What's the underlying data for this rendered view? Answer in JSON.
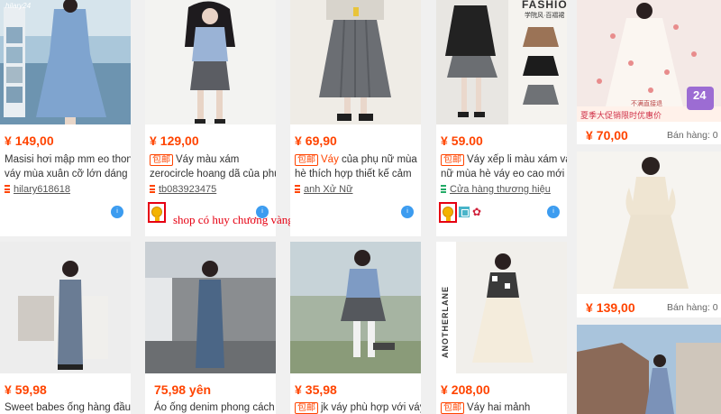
{
  "annotation": "shop có huy chương vàng",
  "row1": [
    {
      "price_currency": "¥",
      "price": "149,00",
      "title": "Masisi hơi mập mm eo thon",
      "title2": "váy mùa xuân cỡ lớn dáng",
      "shop": "hilary618618",
      "watermark": "hilary24"
    },
    {
      "price_currency": "¥",
      "price": "129,00",
      "tag": "包邮",
      "title": "Váy màu xám",
      "title2": "zerocircle hoang dã của phụ",
      "shop": "tb083923475"
    },
    {
      "price_currency": "¥",
      "price": "69,90",
      "tag": "包邮",
      "title_highlight": "Váy",
      "title": "của phụ nữ mùa",
      "title2": "hè thích hợp thiết kế cảm",
      "shop": "anh Xử Nữ"
    },
    {
      "price_currency": "¥",
      "price": "59.00",
      "tag": "包邮",
      "title": "Váy xếp li màu xám váy",
      "title2": "nữ mùa hè váy eo cao mới",
      "shop": "Cửa hàng thương hiệu",
      "photo_brand": "FASHION",
      "photo_sub": "学院风·百褶裙"
    },
    {
      "price_currency": "¥",
      "price": "70,00",
      "sales": "Bán hàng: 0",
      "banner": "夏季大促销限时优惠价",
      "banner_top": "不满直接退",
      "badge_num": "24"
    }
  ],
  "side": [
    {
      "price_currency": "¥",
      "price": "139,00",
      "sales": "Bán hàng: 0"
    }
  ],
  "row2": [
    {
      "price_currency": "¥",
      "price": "59,98",
      "title": "Sweet babes ống hàng đầu"
    },
    {
      "price": "75,98 yên",
      "title": "Áo ống denim phong cách"
    },
    {
      "price_currency": "¥",
      "price": "35,98",
      "tag": "包邮",
      "title": "jk váy phù hợp với váy"
    },
    {
      "price_currency": "¥",
      "price": "208,00",
      "tag": "包邮",
      "title": "Váy hai mảnh",
      "photo_brand": "ANOTHERLANE"
    }
  ],
  "colors": {
    "price": "#ff4400",
    "accent_red": "#e60012",
    "wangwang_blue": "#3c9cf0"
  },
  "icons": {
    "shop_marker": "shop-marker-icon",
    "chat": "wangwang-chat-icon",
    "medal": "gold-medal-icon"
  }
}
